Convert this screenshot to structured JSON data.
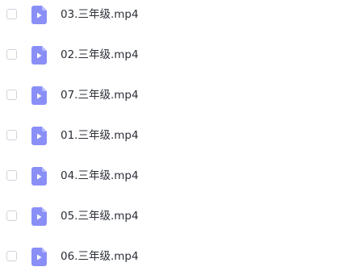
{
  "colors": {
    "icon_fill": "#8a8ff7",
    "icon_fold": "#b9bdfb",
    "play_glyph": "#ffffff",
    "text": "#2b2f36",
    "checkbox_border": "#cfd3da"
  },
  "files": [
    {
      "name": "03.三年级.mp4",
      "icon": "video-file-icon",
      "checked": false
    },
    {
      "name": "02.三年级.mp4",
      "icon": "video-file-icon",
      "checked": false
    },
    {
      "name": "07.三年级.mp4",
      "icon": "video-file-icon",
      "checked": false
    },
    {
      "name": "01.三年级.mp4",
      "icon": "video-file-icon",
      "checked": false
    },
    {
      "name": "04.三年级.mp4",
      "icon": "video-file-icon",
      "checked": false
    },
    {
      "name": "05.三年级.mp4",
      "icon": "video-file-icon",
      "checked": false
    },
    {
      "name": "06.三年级.mp4",
      "icon": "video-file-icon",
      "checked": false
    }
  ]
}
